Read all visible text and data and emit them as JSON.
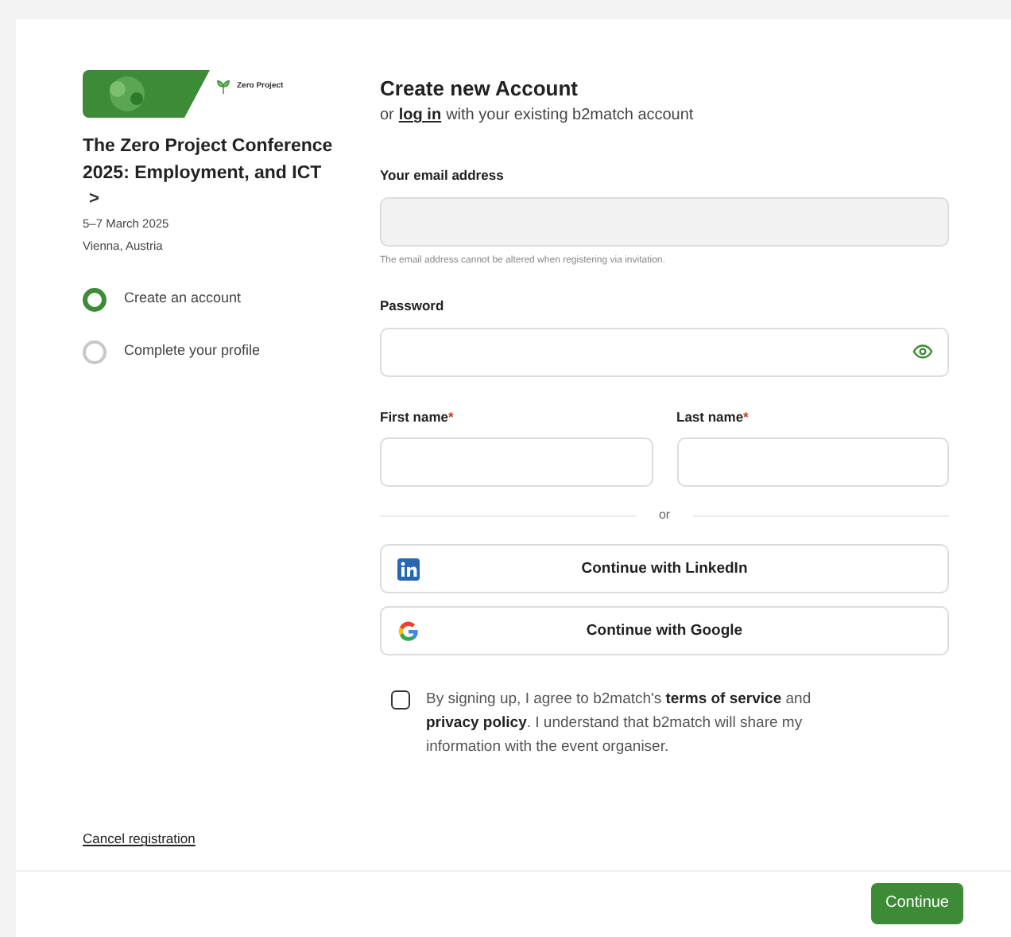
{
  "event": {
    "logo_text": "Zero Project",
    "title": "The Zero Project Conference 2025: Employment, and ICT",
    "chevron": ">",
    "dates": "5–7 March 2025",
    "location": "Vienna, Austria"
  },
  "steps": [
    {
      "label": "Create an account",
      "selected": true
    },
    {
      "label": "Complete your profile",
      "selected": false
    }
  ],
  "cancel_link": "Cancel registration",
  "heading": "Create new Account",
  "subheading": {
    "prefix": "or",
    "link": "log in",
    "suffix": "with your existing b2match account"
  },
  "email": {
    "label": "Your email address",
    "disabled": true,
    "hint": "The email address cannot be altered when registering via invitation."
  },
  "password": {
    "label": "Password"
  },
  "first_name": {
    "label": "First name",
    "required_mark": "*"
  },
  "last_name": {
    "label": "Last name",
    "required_mark": "*"
  },
  "divider_text": "or",
  "social_buttons": [
    {
      "kind": "linkedin",
      "label": "Continue with LinkedIn"
    },
    {
      "kind": "google",
      "label": "Continue with Google"
    }
  ],
  "consent": {
    "checked": false,
    "text": "By signing up, I agree to b2match's **terms of service** and **privacy policy**. I understand that b2match will share my information with the event organiser."
  },
  "continue_button": "Continue"
}
